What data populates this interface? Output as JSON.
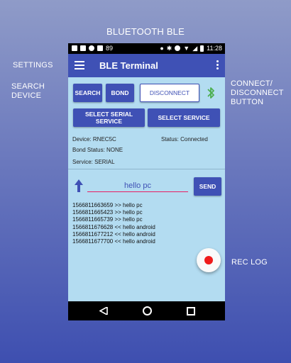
{
  "annotations": {
    "title": "BLUETOOTH BLE",
    "settings": "SETTINGS",
    "search_device": "SEARCH\nDEVICE",
    "connect_disconnect": "CONNECT/\nDISCONNECT\nBUTTON",
    "rec_log": "REC LOG"
  },
  "status_bar": {
    "time": "11:28",
    "left_text": "89"
  },
  "app_bar": {
    "title": "BLE Terminal",
    "menu_icon": "hamburger-icon",
    "overflow_icon": "more-vert-icon"
  },
  "buttons": {
    "search": "SEARCH",
    "bond": "BOND",
    "disconnect": "DISCONNECT",
    "select_serial_service": "SELECT SERIAL SERVICE",
    "select_service": "SELECT SERVICE",
    "send": "SEND"
  },
  "info": {
    "device": "Device: RNEC5C",
    "status": "Status: Connected",
    "bond_status": "Bond Status: NONE",
    "service": "Service: SERIAL"
  },
  "message_input": {
    "value": "hello pc"
  },
  "log": [
    "1566811663659 >> hello pc",
    "1566811665423 >> hello pc",
    "1566811665739 >> hello pc",
    "1566811676628 << hello android",
    "1566811677212 << hello android",
    "1566811677700 << hello android"
  ],
  "colors": {
    "primary": "#3f51b5",
    "screen_bg": "#b3dcf1",
    "bluetooth_connected": "#4caf50",
    "rec": "#ef1b1b"
  }
}
